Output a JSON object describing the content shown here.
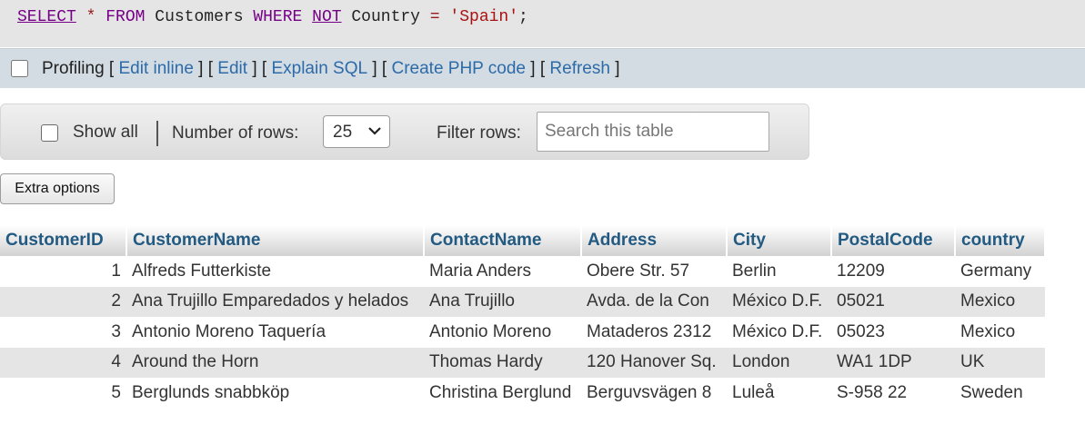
{
  "sql": {
    "select_kw": "SELECT",
    "star": "*",
    "from_kw": "FROM",
    "table": "Customers",
    "where_kw": "WHERE",
    "not_kw": "NOT",
    "column": "Country",
    "eq": "=",
    "value": "'Spain'",
    "semicolon": ";"
  },
  "profiling": {
    "label": "Profiling",
    "links": [
      "Edit inline",
      "Edit",
      "Explain SQL",
      "Create PHP code",
      "Refresh"
    ]
  },
  "navigation": {
    "show_all_label": "Show all",
    "rows_label": "Number of rows:",
    "rows_value": "25",
    "filter_label": "Filter rows:",
    "search_placeholder": "Search this table"
  },
  "extra_options_label": "Extra options",
  "table": {
    "columns": [
      "CustomerID",
      "CustomerName",
      "ContactName",
      "Address",
      "City",
      "PostalCode",
      "country"
    ],
    "rows": [
      [
        "1",
        "Alfreds Futterkiste",
        "Maria Anders",
        "Obere Str. 57",
        "Berlin",
        "12209",
        "Germany"
      ],
      [
        "2",
        "Ana Trujillo Emparedados y helados",
        "Ana Trujillo",
        "Avda. de la Con",
        "México D.F.",
        "05021",
        "Mexico"
      ],
      [
        "3",
        "Antonio Moreno Taquería",
        "Antonio Moreno",
        "Mataderos 2312",
        "México D.F.",
        "05023",
        "Mexico"
      ],
      [
        "4",
        "Around the Horn",
        "Thomas Hardy",
        "120 Hanover Sq.",
        "London",
        "WA1 1DP",
        "UK"
      ],
      [
        "5",
        "Berglunds snabbköp",
        "Christina Berglund",
        "Berguvsvägen 8",
        "Luleå",
        "S-958 22",
        "Sweden"
      ]
    ]
  },
  "colors": {
    "header_text": "#235a81",
    "link": "#2d6aa8",
    "keyword": "#770088",
    "string": "#aa1111",
    "profiling_bg": "#d3dce3",
    "row_alt_bg": "#e5e5e5"
  }
}
